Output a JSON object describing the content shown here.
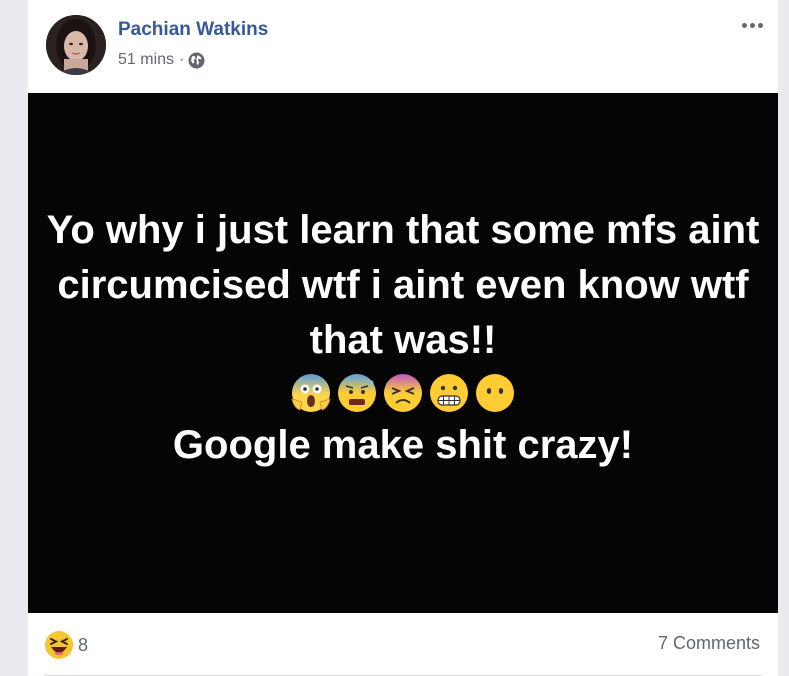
{
  "post": {
    "author": "Pachian Watkins",
    "timestamp": "51 mins",
    "separator": "·",
    "privacy_icon": "globe-icon",
    "more_icon": "more-options-icon",
    "body_lines": [
      "Yo why i just learn that some mfs aint circumcised wtf i aint even know wtf that was!!",
      "Google make shit crazy!"
    ],
    "body_emojis": [
      "screaming-face-emoji",
      "anxious-sweat-face-emoji",
      "confounded-face-emoji",
      "grimacing-face-emoji",
      "no-mouth-face-emoji"
    ],
    "background_color": "#050505",
    "text_color": "#ffffff"
  },
  "footer": {
    "reaction_icon": "haha-reaction-icon",
    "reaction_count": "8",
    "comments_label": "7 Comments"
  },
  "colors": {
    "author_link": "#385898",
    "meta_text": "#616770",
    "page_bg": "#e9ebee"
  }
}
